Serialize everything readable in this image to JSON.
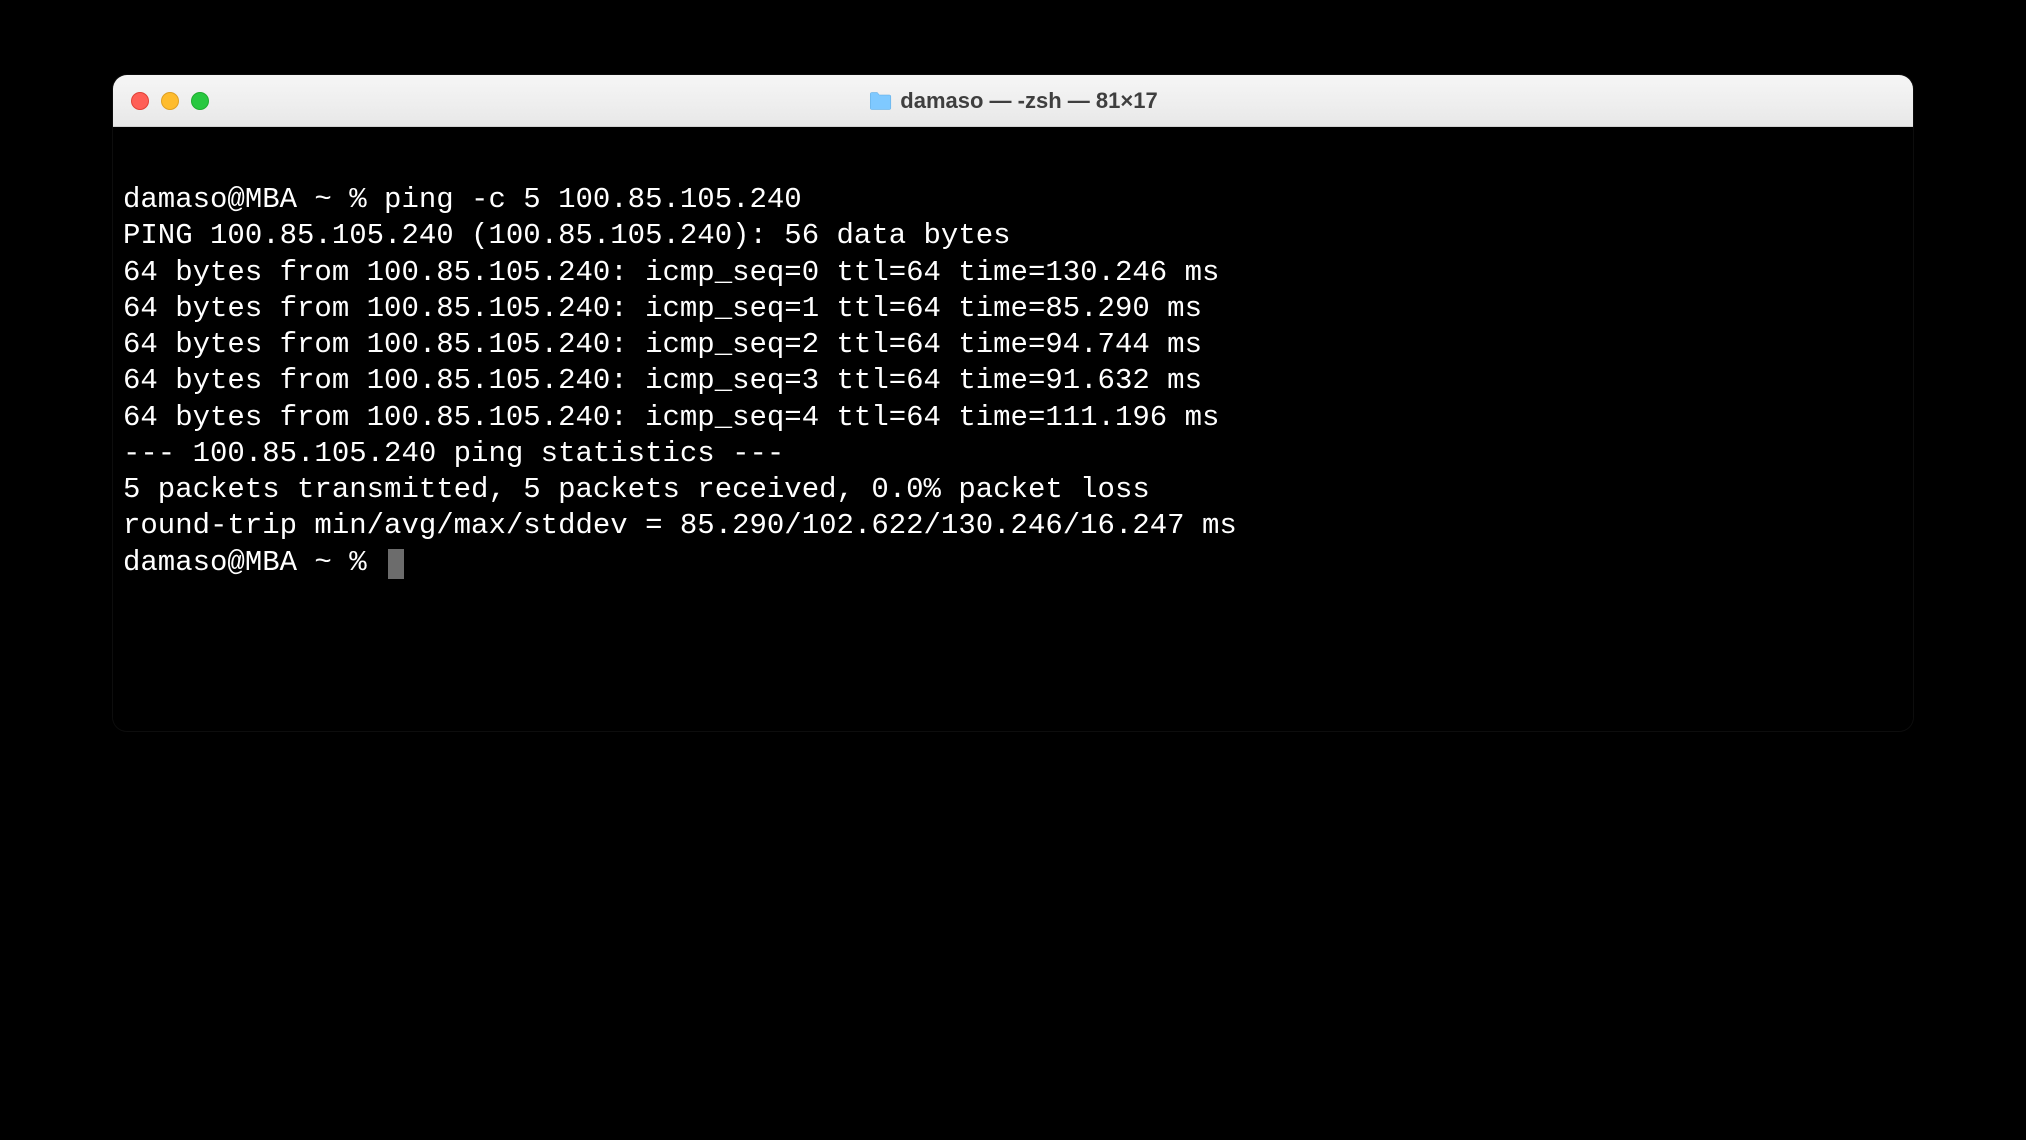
{
  "window": {
    "title": "damaso — -zsh — 81×17"
  },
  "terminal": {
    "lines": [
      "damaso@MBA ~ % ping -c 5 100.85.105.240",
      "PING 100.85.105.240 (100.85.105.240): 56 data bytes",
      "64 bytes from 100.85.105.240: icmp_seq=0 ttl=64 time=130.246 ms",
      "64 bytes from 100.85.105.240: icmp_seq=1 ttl=64 time=85.290 ms",
      "64 bytes from 100.85.105.240: icmp_seq=2 ttl=64 time=94.744 ms",
      "64 bytes from 100.85.105.240: icmp_seq=3 ttl=64 time=91.632 ms",
      "64 bytes from 100.85.105.240: icmp_seq=4 ttl=64 time=111.196 ms",
      "",
      "--- 100.85.105.240 ping statistics ---",
      "5 packets transmitted, 5 packets received, 0.0% packet loss",
      "round-trip min/avg/max/stddev = 85.290/102.622/130.246/16.247 ms"
    ],
    "prompt": "damaso@MBA ~ % "
  }
}
